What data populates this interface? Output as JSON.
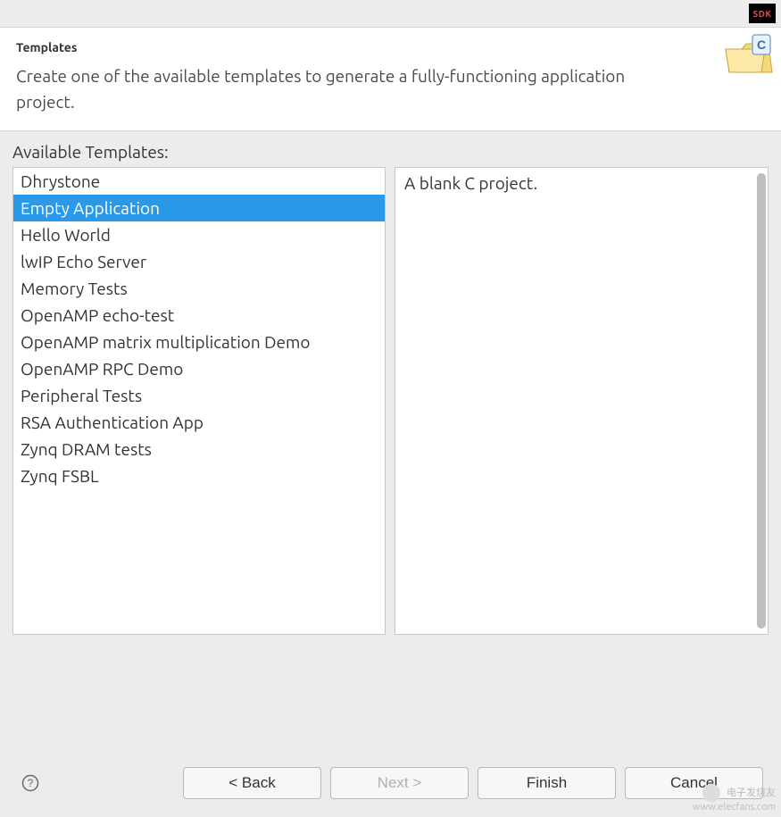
{
  "window": {
    "sdk_badge": "SDK"
  },
  "header": {
    "title": "Templates",
    "description": "Create one of the available templates to generate a fully-functioning application project."
  },
  "section_label": "Available Templates:",
  "templates": [
    {
      "name": "Dhrystone",
      "selected": false
    },
    {
      "name": "Empty Application",
      "selected": true
    },
    {
      "name": "Hello World",
      "selected": false
    },
    {
      "name": "lwIP Echo Server",
      "selected": false
    },
    {
      "name": "Memory Tests",
      "selected": false
    },
    {
      "name": "OpenAMP echo-test",
      "selected": false
    },
    {
      "name": "OpenAMP matrix multiplication Demo",
      "selected": false
    },
    {
      "name": "OpenAMP RPC Demo",
      "selected": false
    },
    {
      "name": "Peripheral Tests",
      "selected": false
    },
    {
      "name": "RSA Authentication App",
      "selected": false
    },
    {
      "name": "Zynq DRAM tests",
      "selected": false
    },
    {
      "name": "Zynq FSBL",
      "selected": false
    }
  ],
  "description_pane": "A blank C project.",
  "buttons": {
    "back": "< Back",
    "next": "Next >",
    "finish": "Finish",
    "cancel": "Cancel"
  },
  "watermark": {
    "line1": "电子发烧友",
    "line2": "www.elecfans.com"
  }
}
